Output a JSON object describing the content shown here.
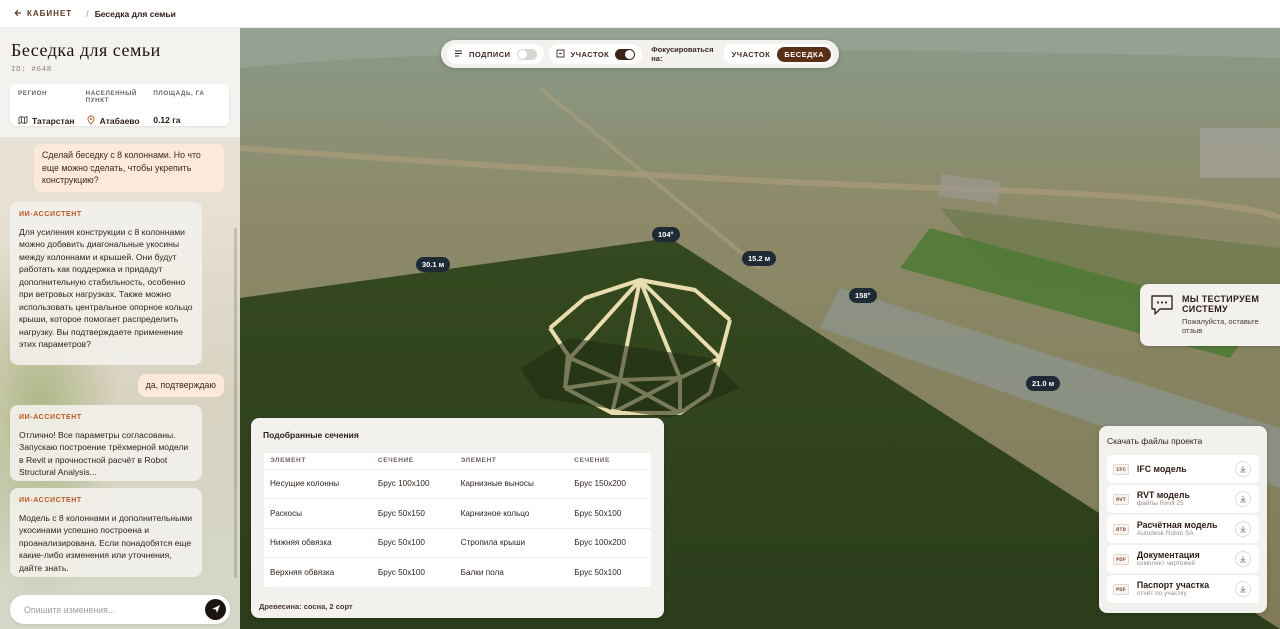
{
  "header": {
    "back_label": "КАБИНЕТ",
    "separator": "/",
    "breadcrumb": "Беседка для семьи"
  },
  "project": {
    "title": "Беседка для семьи",
    "id": "ID: #648",
    "meta": [
      {
        "label": "РЕГИОН",
        "value": "Татарстан",
        "icon": "map-icon"
      },
      {
        "label": "НАСЕЛЕННЫЙ ПУНКТ",
        "value": "Атабаево",
        "icon": "pin-icon"
      },
      {
        "label": "ПЛОЩАДЬ, ГА",
        "value": "0.12 га",
        "icon": ""
      }
    ]
  },
  "chat": {
    "messages": [
      {
        "role": "user",
        "text": "Сделай беседку с 8 колоннами. Но что еще можно сделать, чтобы укрепить конструкцию?"
      },
      {
        "role": "assistant",
        "label": "ИИ-АССИСТЕНТ",
        "text": "Для усиления конструкции с 8 колоннами можно добавить диагональные укосины между колоннами и крышей. Они будут работать как поддержка и придадут дополнительную стабильность, особенно при ветровых нагрузках. Также можно использовать центральное опорное кольцо крыши, которое помогает распределить нагрузку. Вы подтверждаете применение этих параметров?"
      },
      {
        "role": "user",
        "text": "да, подтверждаю"
      },
      {
        "role": "assistant",
        "label": "ИИ-АССИСТЕНТ",
        "text": "Отлично! Все параметры согласованы. Запускаю построение трёхмерной модели в Revit и прочностной расчёт в Robot Structural Analysis..."
      },
      {
        "role": "assistant",
        "label": "ИИ-АССИСТЕНТ",
        "text": "Модель с 8 колоннами и дополнительными укосинами успешно построена и проанализирована. Если понадобятся еще какие-либо изменения или уточнения, дайте знать."
      }
    ],
    "input_placeholder": "Опишите изменения..."
  },
  "toolbar": {
    "labels_toggle": {
      "label": "ПОДПИСИ",
      "on": false
    },
    "plot_toggle": {
      "label": "УЧАСТОК",
      "on": true
    },
    "focus_label": "Фокусироваться на:",
    "focus_options": [
      "УЧАСТОК",
      "БЕСЕДКА"
    ],
    "focus_selected": "БЕСЕДКА"
  },
  "dimensions": [
    "104°",
    "30.1 м",
    "15.2 м",
    "158°",
    "21.0 м"
  ],
  "feedback": {
    "title": "МЫ ТЕСТИРУЕМ СИСТЕМУ",
    "subtitle": "Пожалуйста, оставьте отзыв"
  },
  "sections": {
    "title": "Подобранные сечения",
    "headers": [
      "ЭЛЕМЕНТ",
      "СЕЧЕНИЕ",
      "ЭЛЕМЕНТ",
      "СЕЧЕНИЕ"
    ],
    "rows": [
      [
        "Несущие колонны",
        "Брус 100x100",
        "Карнизные выносы",
        "Брус 150x200"
      ],
      [
        "Раскосы",
        "Брус 50x150",
        "Карнизное кольцо",
        "Брус 50x100"
      ],
      [
        "Нижняя обвязка",
        "Брус 50x100",
        "Стропила крыши",
        "Брус 100x200"
      ],
      [
        "Верхняя обвязка",
        "Брус 50x100",
        "Балки пола",
        "Брус 50x100"
      ]
    ],
    "footer": "Древесина: сосна, 2 сорт"
  },
  "files": {
    "title": "Скачать файлы проекта",
    "items": [
      {
        "tag": "IFC",
        "name": "IFC модель",
        "sub": ""
      },
      {
        "tag": "RVT",
        "name": "RVT модель",
        "sub": "файлы Revit 25"
      },
      {
        "tag": "RTD",
        "name": "Расчётная модель",
        "sub": "Autodesk Robot SA"
      },
      {
        "tag": "PDF",
        "name": "Документация",
        "sub": "комплект чертежей"
      },
      {
        "tag": "PDF",
        "name": "Паспорт участка",
        "sub": "отчёт по участку"
      }
    ]
  },
  "colors": {
    "accent": "#5a2e17",
    "ai_label": "#c0571d",
    "user_bubble": "#fbe9dc",
    "ground": "#2f4420"
  }
}
